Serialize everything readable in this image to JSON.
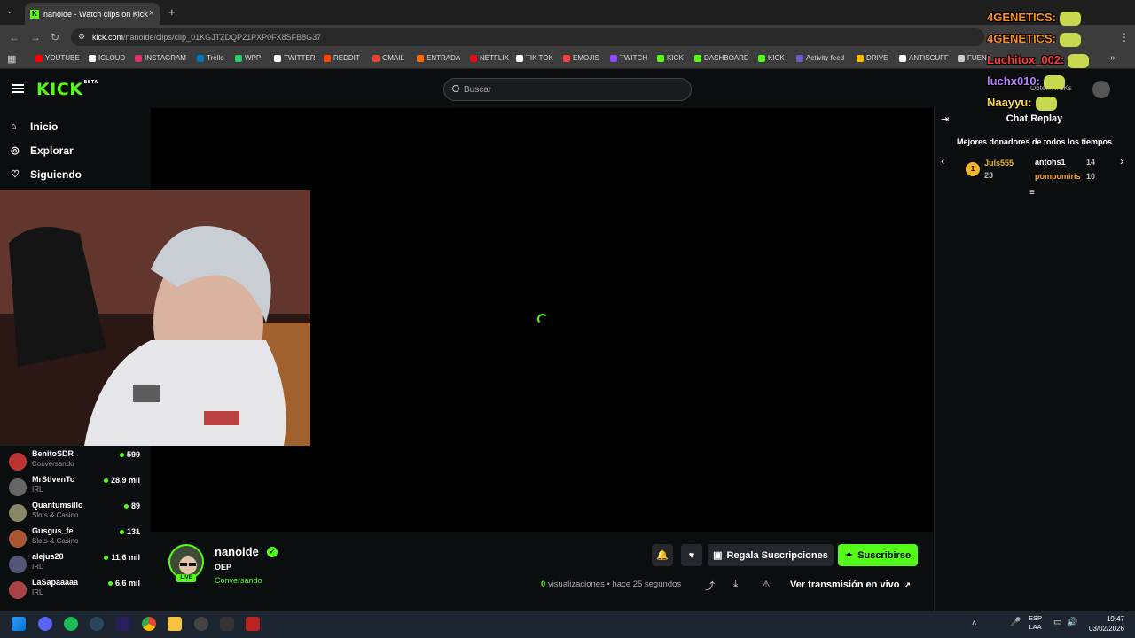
{
  "browser": {
    "tab_title": "nanoide - Watch clips on Kick",
    "new_tab_symbol": "+",
    "url_host": "kick.com",
    "url_path": "/nanoide/clips/clip_01KGJTZDQP21PXP0FX8SFB8G37",
    "bookmarks": [
      {
        "label": "YOUTUBE",
        "color": "#ff0000"
      },
      {
        "label": "ICLOUD",
        "color": "#ffffff"
      },
      {
        "label": "INSTAGRAM",
        "color": "#e1306c"
      },
      {
        "label": "Trello",
        "color": "#0079bf"
      },
      {
        "label": "WPP",
        "color": "#25d366"
      },
      {
        "label": "TWITTER",
        "color": "#ffffff"
      },
      {
        "label": "REDDIT",
        "color": "#ff4500"
      },
      {
        "label": "GMAIL",
        "color": "#ea4335"
      },
      {
        "label": "ENTRADA",
        "color": "#ff6b00"
      },
      {
        "label": "NETFLIX",
        "color": "#e50914"
      },
      {
        "label": "TIK TOK",
        "color": "#ffffff"
      },
      {
        "label": "EMOJIS",
        "color": "#ff3b3b"
      },
      {
        "label": "TWITCH",
        "color": "#9146ff"
      },
      {
        "label": "KICK",
        "color": "#53fc18"
      },
      {
        "label": "DASHBOARD",
        "color": "#53fc18"
      },
      {
        "label": "KICK",
        "color": "#53fc18"
      },
      {
        "label": "Activity feed",
        "color": "#6a5acd"
      },
      {
        "label": "DRIVE",
        "color": "#fbbc04"
      },
      {
        "label": "ANTISCUFF",
        "color": "#ffffff"
      },
      {
        "label": "FUEN",
        "color": "#cccccc"
      }
    ]
  },
  "kick": {
    "logo": "KICK",
    "logo_badge": "BETA",
    "search_placeholder": "Buscar",
    "nav": [
      {
        "label": "Inicio",
        "icon": "home-icon"
      },
      {
        "label": "Explorar",
        "icon": "compass-icon"
      },
      {
        "label": "Siguiendo",
        "icon": "heart-icon"
      }
    ],
    "channels": [
      {
        "name": "BenitoSDR",
        "category": "Conversando",
        "viewers": "599"
      },
      {
        "name": "MrStivenTc",
        "category": "IRL",
        "viewers": "28,9 mil"
      },
      {
        "name": "Quantumsillo",
        "category": "Slots & Casino",
        "viewers": "89"
      },
      {
        "name": "Gusgus_fe",
        "category": "Slots & Casino",
        "viewers": "131"
      },
      {
        "name": "alejus28",
        "category": "IRL",
        "viewers": "11,6 mil"
      },
      {
        "name": "LaSapaaaaa",
        "category": "IRL",
        "viewers": "6,6 mil"
      }
    ]
  },
  "clip": {
    "channel_name": "nanoide",
    "live_badge": "LIVE",
    "title": "OEP",
    "category": "Conversando",
    "views_count": "0",
    "views_label": "visualizaciones",
    "time_ago": "hace 25 segundos",
    "gift_label": "Regala Suscripciones",
    "subscribe_label": "Suscribirse",
    "watch_live_label": "Ver transmisión en vivo"
  },
  "chat": {
    "title": "Chat Replay",
    "donors_title": "Mejores donadores de todos los tiempos",
    "donors": [
      {
        "rank": "1",
        "name": "Juls555",
        "amount": "23"
      },
      {
        "name": "antohs1",
        "amount": "14"
      },
      {
        "name": "pompomiris",
        "amount": "10"
      }
    ],
    "get_kicks": "Obtén KICKs"
  },
  "overlay_chat": [
    {
      "user": "4GENETICS:",
      "color": "#ff8c1a"
    },
    {
      "user": "4GENETICS:",
      "color": "#ff8c1a"
    },
    {
      "user": "Luchitox_002:",
      "color": "#ff3b3b"
    },
    {
      "user": "luchx010:",
      "color": "#b57cff"
    },
    {
      "user": "Naayyu:",
      "color": "#ffd84a"
    }
  ],
  "taskbar": {
    "lang_top": "ESP",
    "lang_bottom": "LAA",
    "time": "19:47",
    "date": "03/02/2026"
  },
  "colors": {
    "accent": "#53fc18",
    "background": "#0b0e0f"
  }
}
